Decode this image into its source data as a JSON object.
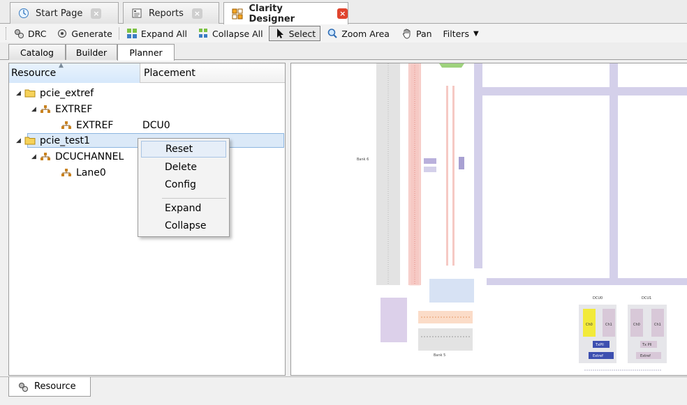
{
  "doc_tabs": [
    {
      "label": "Start Page",
      "icon": "start-page-icon",
      "close": "×",
      "active": false
    },
    {
      "label": "Reports",
      "icon": "reports-icon",
      "close": "×",
      "active": false
    },
    {
      "label": "Clarity Designer",
      "icon": "clarity-designer-icon",
      "close": "×",
      "active": true
    }
  ],
  "toolbar": {
    "drc": "DRC",
    "generate": "Generate",
    "expand_all": "Expand All",
    "collapse_all": "Collapse All",
    "select": "Select",
    "zoom_area": "Zoom Area",
    "pan": "Pan",
    "filters": "Filters",
    "filters_caret": "▼"
  },
  "view_tabs": [
    "Catalog",
    "Builder",
    "Planner"
  ],
  "view_tab_active": "Planner",
  "tree": {
    "columns": {
      "resource": "Resource",
      "placement": "Placement"
    },
    "rows": [
      {
        "label": "pcie_extref",
        "placement": "",
        "icon": "folder-icon",
        "expanded": true
      },
      {
        "label": "EXTREF",
        "placement": "",
        "icon": "component-icon",
        "expanded": true
      },
      {
        "label": "EXTREF",
        "placement": "DCU0",
        "icon": "component-icon"
      },
      {
        "label": "pcie_test1",
        "placement": "",
        "icon": "folder-icon",
        "expanded": true,
        "selected": true
      },
      {
        "label": "DCUCHANNEL",
        "placement": "",
        "icon": "component-icon",
        "expanded": true
      },
      {
        "label": "Lane0",
        "placement": "",
        "icon": "component-icon"
      }
    ],
    "twisty_open": "◢"
  },
  "context_menu": {
    "items": [
      "Reset",
      "Delete",
      "Config",
      "Expand",
      "Collapse"
    ],
    "hover": "Reset"
  },
  "canvas": {
    "bank_labels": [
      "Bank 6",
      "Bank 5"
    ],
    "dcu_labels": [
      "DCU0",
      "DCU1"
    ],
    "channel_labels": [
      "Ch0",
      "Ch1",
      "Ch0",
      "Ch1"
    ],
    "tx_pll_labels": [
      "TxPll",
      "Tx Pll"
    ],
    "extref_labels": [
      "Extref",
      "Extref"
    ]
  },
  "colors": {
    "selection": "#dbe9f8",
    "active_close": "#e0442e",
    "bank_gray": "#e3e3e3",
    "io_pink": "#f6c9c4",
    "routing_lavender": "#d4d0ea",
    "dcu_yellow": "#f2ea3a",
    "txpll_blue": "#3d4fb0"
  },
  "bottom_tab": {
    "label": "Resource",
    "icon": "resource-icon"
  }
}
